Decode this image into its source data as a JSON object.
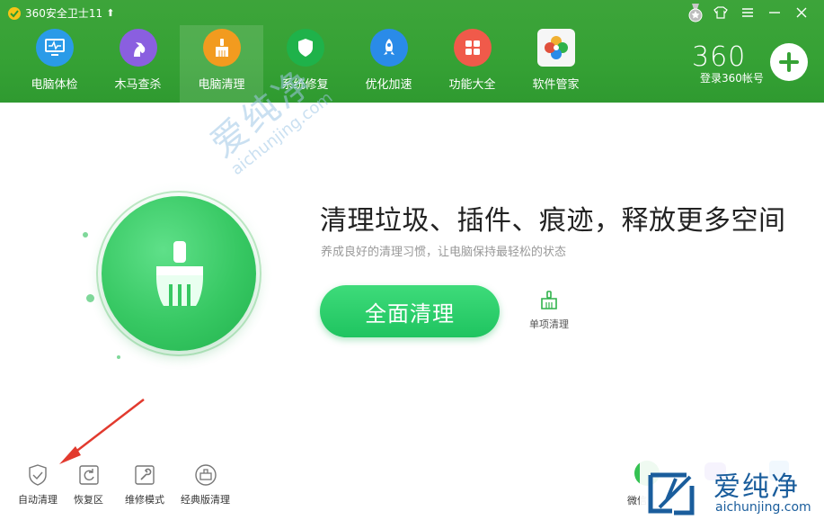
{
  "app": {
    "title": "360安全卫士11",
    "brand": "360",
    "account_label": "登录360帐号"
  },
  "nav": [
    {
      "label": "电脑体检",
      "icon": "monitor-icon",
      "color": "#2a9be8"
    },
    {
      "label": "木马查杀",
      "icon": "horse-icon",
      "color": "#8a5fe0"
    },
    {
      "label": "电脑清理",
      "icon": "broom-icon",
      "color": "#f29b1f",
      "active": true
    },
    {
      "label": "系统修复",
      "icon": "shield-icon",
      "color": "#1fb24a"
    },
    {
      "label": "优化加速",
      "icon": "rocket-icon",
      "color": "#2a8be8"
    },
    {
      "label": "功能大全",
      "icon": "grid-icon",
      "color": "#f05a4a"
    },
    {
      "label": "软件管家",
      "icon": "flower-icon",
      "color": "#f0b030"
    }
  ],
  "main": {
    "headline": "清理垃圾、插件、痕迹，释放更多空间",
    "subline": "养成良好的清理习惯，让电脑保持最轻松的状态",
    "clean_button": "全面清理",
    "single_clean": "单项清理"
  },
  "tools": [
    {
      "label": "自动清理",
      "icon": "shield-check-icon"
    },
    {
      "label": "恢复区",
      "icon": "restore-icon"
    },
    {
      "label": "维修模式",
      "icon": "wrench-icon"
    },
    {
      "label": "经典版清理",
      "icon": "classic-icon"
    }
  ],
  "bottom_right": {
    "wechat_label": "微信"
  },
  "watermark": {
    "cn": "爱纯净",
    "url": "aichunjing.com"
  },
  "colors": {
    "header_green": "#36a235",
    "button_green": "#1fc460",
    "arrow_red": "#e23a2e"
  }
}
